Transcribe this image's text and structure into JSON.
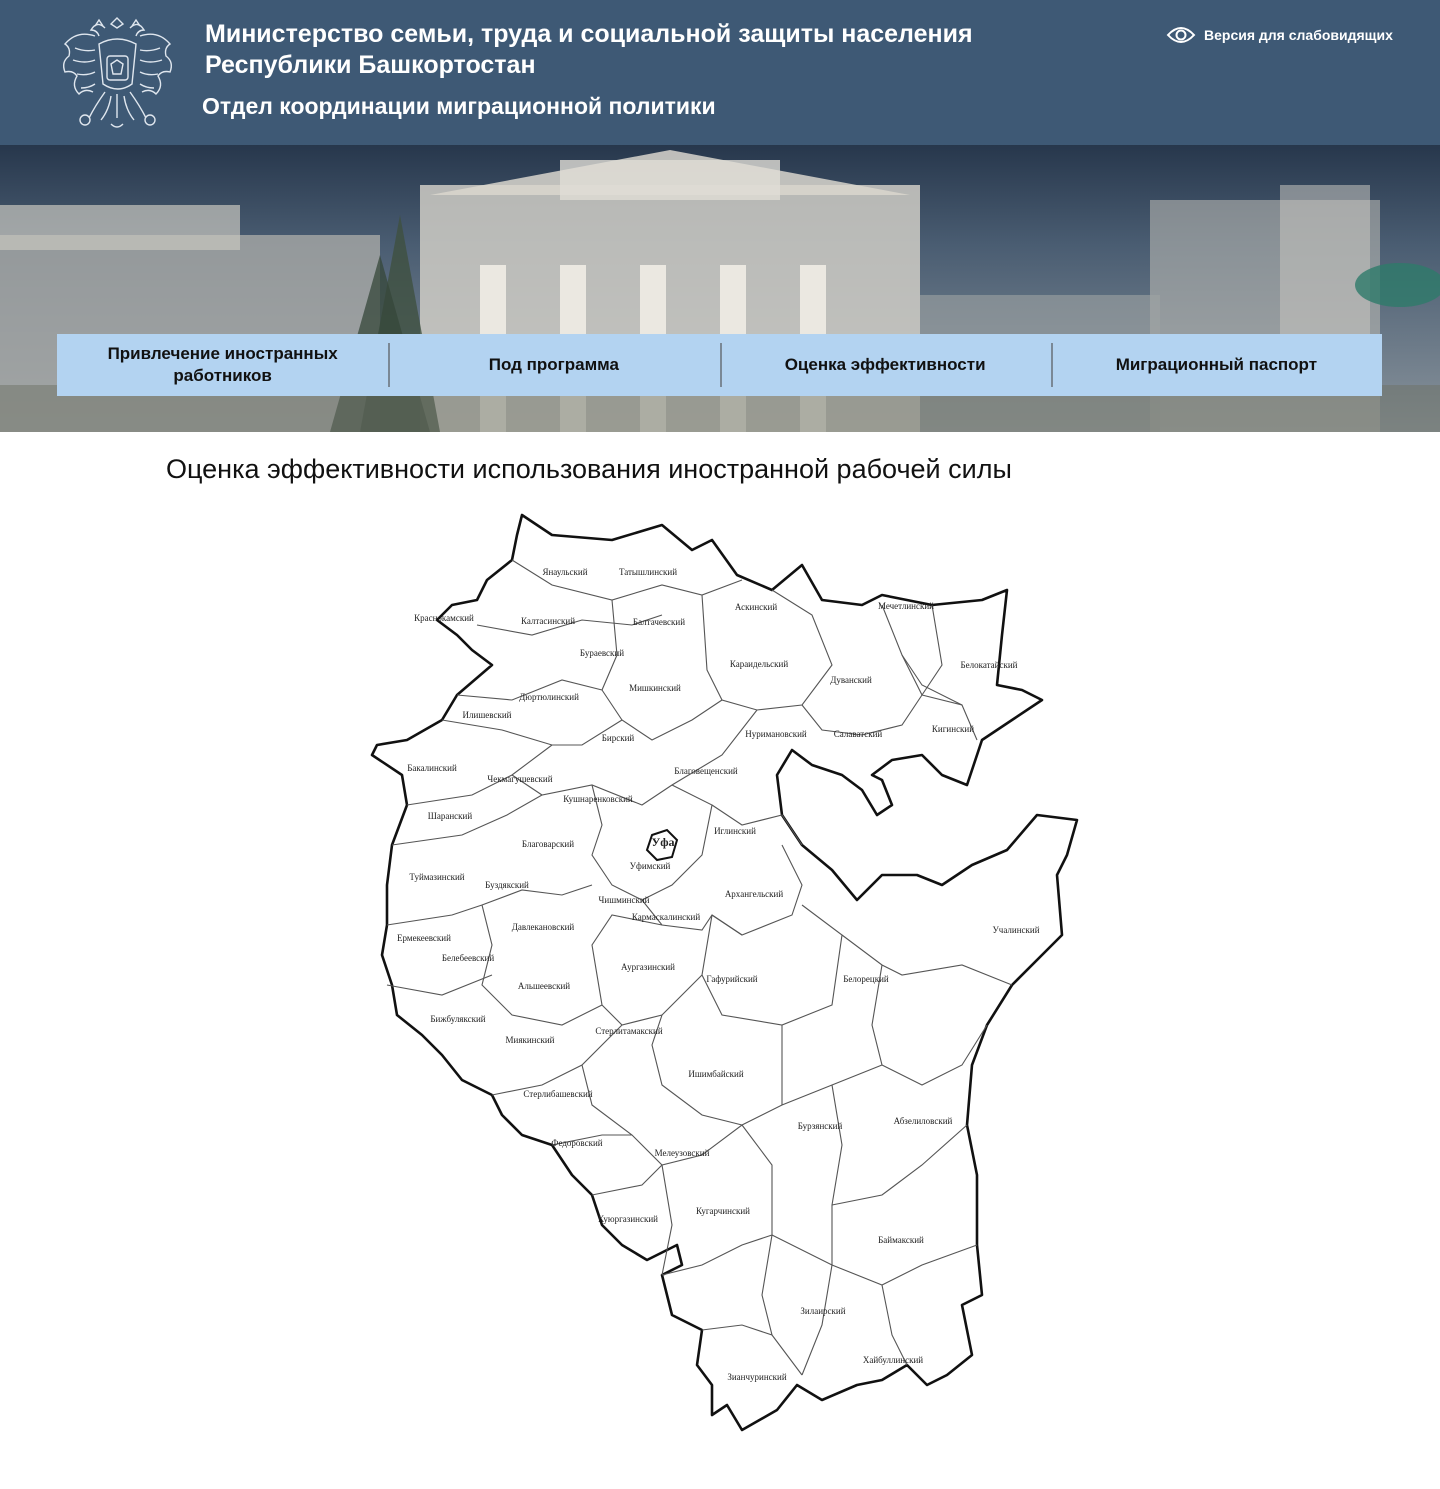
{
  "header": {
    "ministry": "Министерство семьи, труда и социальной защиты населения Республики Башкортостан",
    "department": "Отдел координации миграционной политики",
    "accessibility_label": "Версия для слабовидящих"
  },
  "nav": {
    "items": [
      {
        "label": "Привлечение иностранных работников"
      },
      {
        "label": "Под программа"
      },
      {
        "label": "Оценка эффективности"
      },
      {
        "label": "Миграционный паспорт"
      }
    ]
  },
  "main": {
    "title": "Оценка эффективности использования иностранной рабочей силы"
  },
  "map": {
    "capital": "Уфа",
    "districts": [
      "Янаульский",
      "Татышлинский",
      "Краснокамский",
      "Калтасинский",
      "Балтачевский",
      "Аскинский",
      "Мечетлинский",
      "Бураевский",
      "Караидельский",
      "Дуванский",
      "Белокатайский",
      "Дюртюлинский",
      "Мишкинский",
      "Илишевский",
      "Бирский",
      "Нуримановский",
      "Салаватский",
      "Кигинский",
      "Бакалинский",
      "Чекмагушевский",
      "Благовещенский",
      "Кушнаренковский",
      "Шаранский",
      "Иглинский",
      "Благоварский",
      "Уфимский",
      "Туймазинский",
      "Буздякский",
      "Архангельский",
      "Чишминский",
      "Кармаскалинский",
      "Учалинский",
      "Давлекановский",
      "Ермекеевский",
      "Белебеевский",
      "Аургазинский",
      "Альшеевский",
      "Гафурийский",
      "Белорецкий",
      "Бижбулякский",
      "Стерлитамакский",
      "Миякинский",
      "Ишимбайский",
      "Стерлибашевский",
      "Бурзянский",
      "Абзелиловский",
      "Федоровский",
      "Мелеузовский",
      "Куюргазинский",
      "Кугарчинский",
      "Баймакский",
      "Зилаирский",
      "Хайбуллинский",
      "Зианчуринский"
    ]
  }
}
